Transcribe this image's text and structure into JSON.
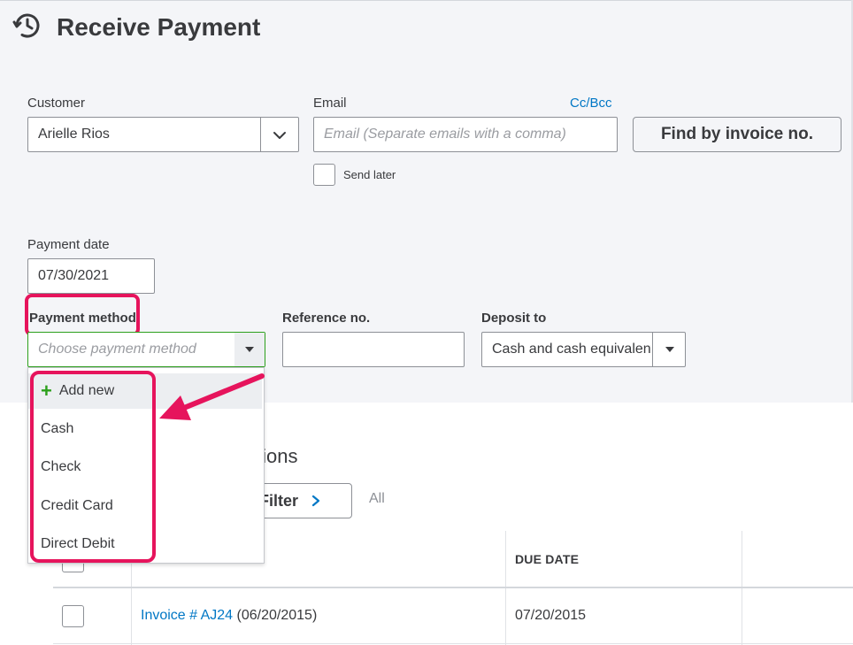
{
  "page": {
    "title": "Receive Payment",
    "icon": "clock-history-icon"
  },
  "customer": {
    "label": "Customer",
    "value": "Arielle Rios"
  },
  "email": {
    "label": "Email",
    "placeholder": "Email (Separate emails with a comma)",
    "ccbcc_link": "Cc/Bcc",
    "send_later_label": "Send later"
  },
  "find_button": "Find by invoice no.",
  "payment_date": {
    "label": "Payment date",
    "value": "07/30/2021"
  },
  "payment_method": {
    "label": "Payment method",
    "placeholder": "Choose payment method",
    "options": [
      "Add new",
      "Cash",
      "Check",
      "Credit Card",
      "Direct Debit"
    ]
  },
  "reference": {
    "label": "Reference no.",
    "value": ""
  },
  "deposit_to": {
    "label": "Deposit to",
    "value": "Cash and cash equivalents"
  },
  "outstanding": {
    "title_fragment": "tions",
    "filter_label": "Filter",
    "all_label": "All"
  },
  "table": {
    "headers": {
      "due_date": "DUE DATE"
    },
    "rows": [
      {
        "invoice": "Invoice # AJ24",
        "invoice_date": "(06/20/2015)",
        "due_date": "07/20/2015"
      }
    ]
  },
  "colors": {
    "highlight": "#e6145c",
    "link": "#0077c5",
    "accent_green": "#2ca01c"
  }
}
